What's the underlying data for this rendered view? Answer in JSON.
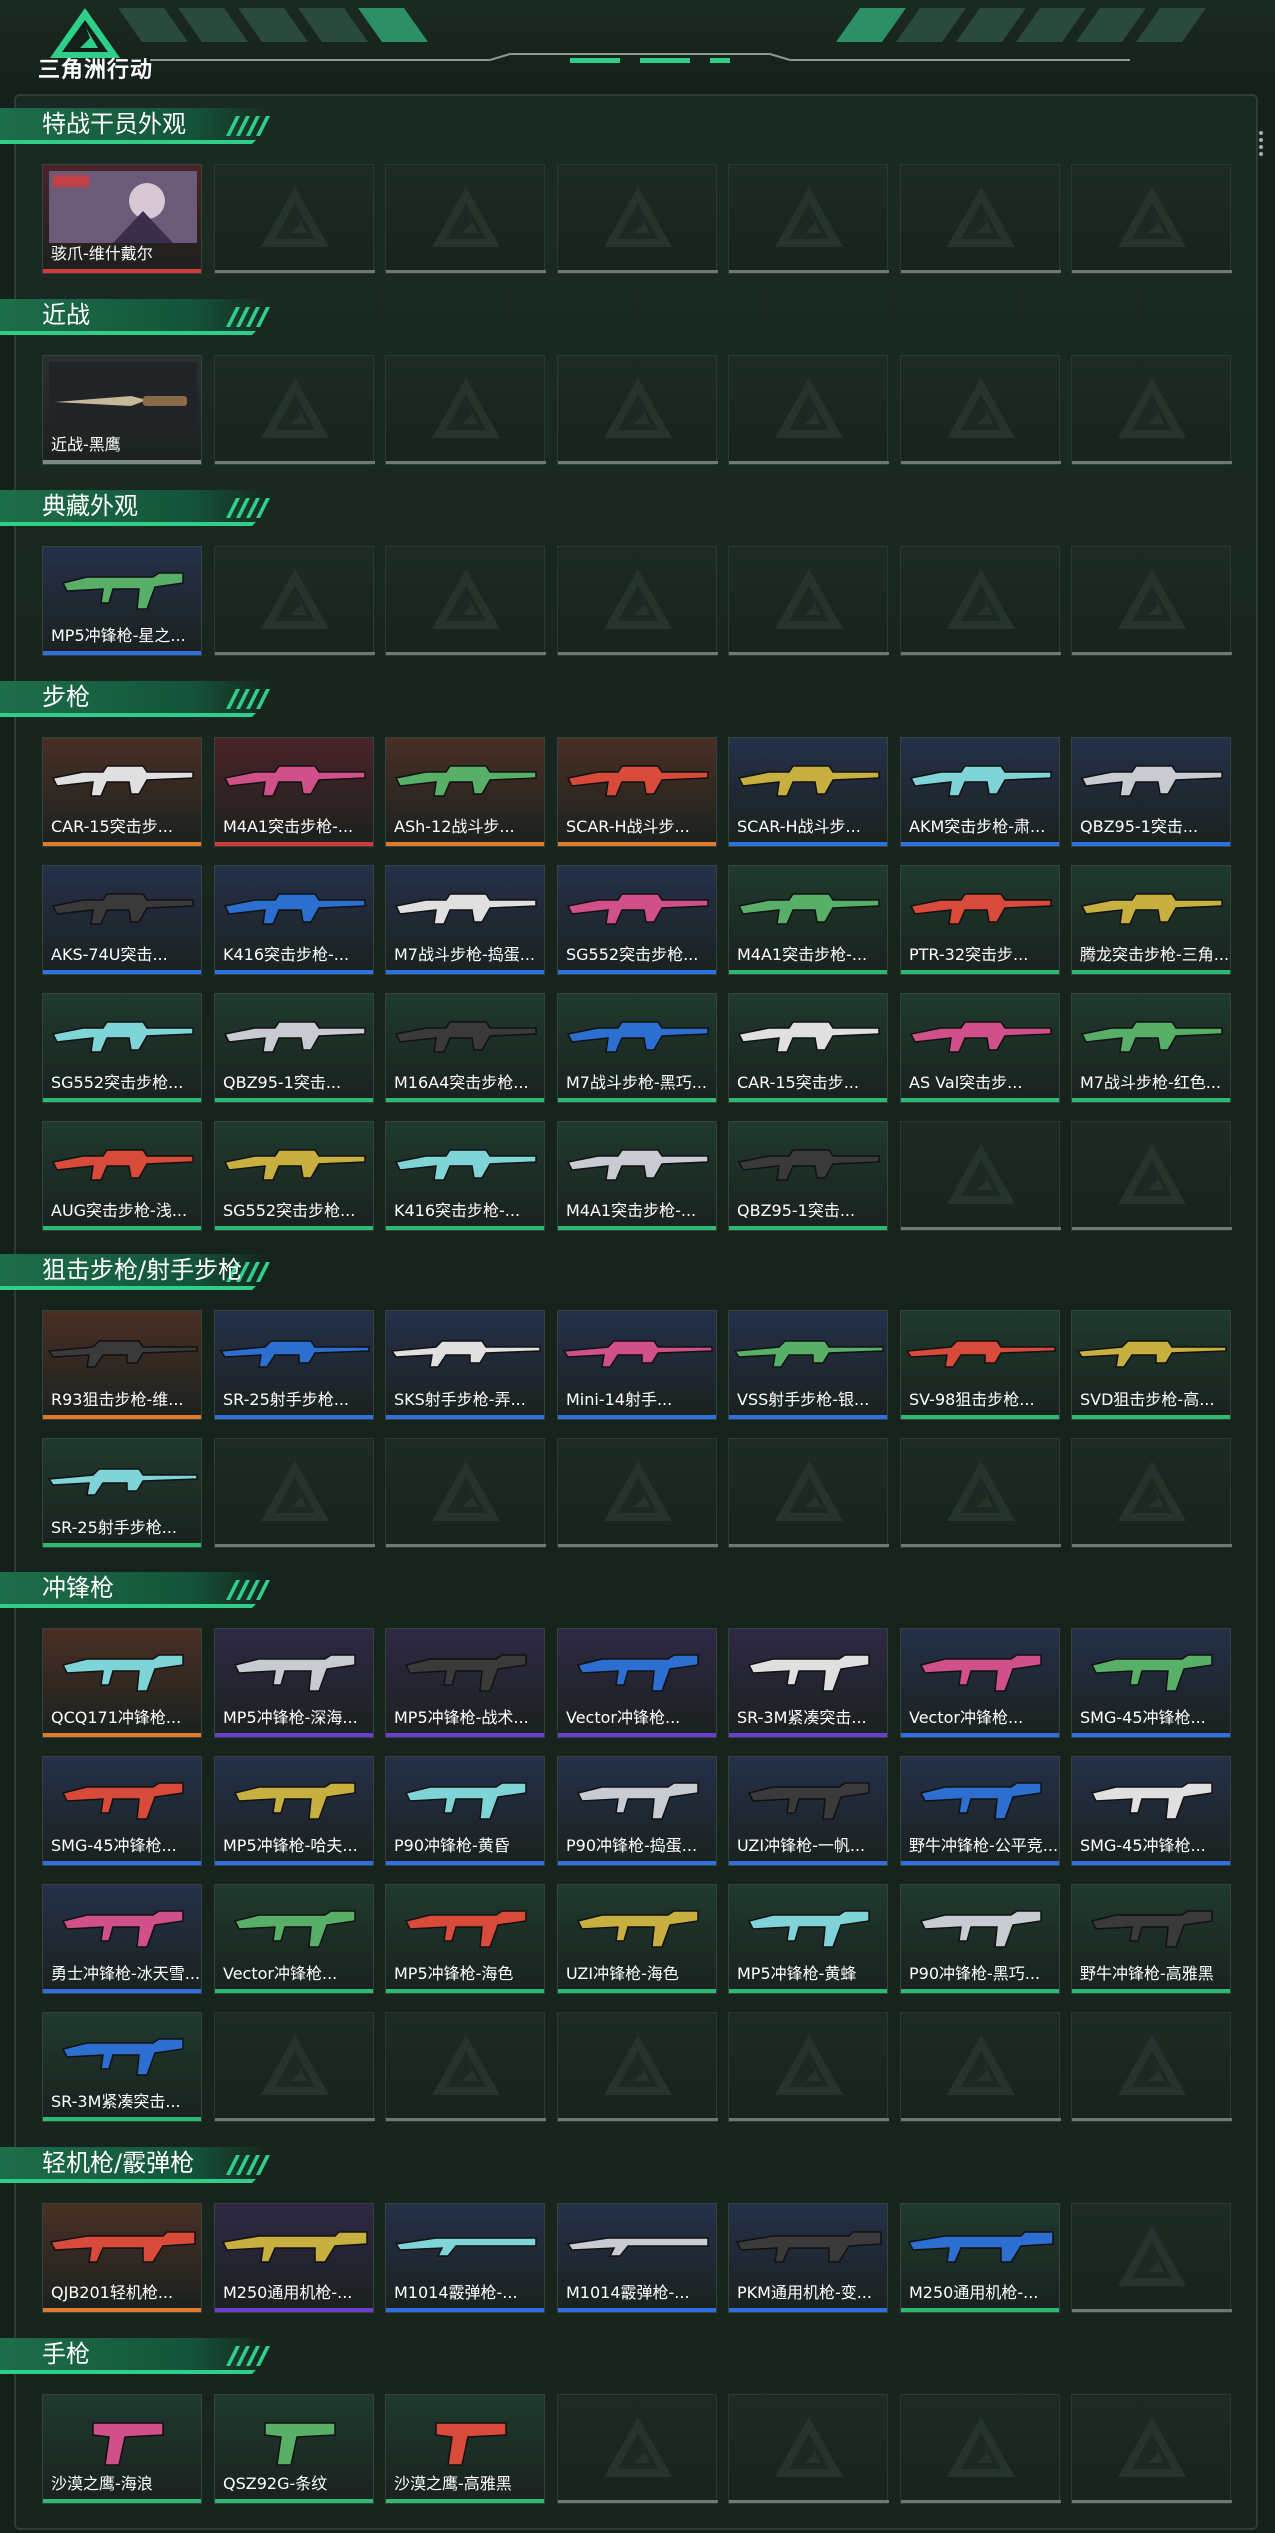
{
  "app": {
    "logo_text": "三角洲行动"
  },
  "colors": {
    "accent": "#2ecc71",
    "rarity": {
      "orange": "#e07a2e",
      "purple": "#6a3fd0",
      "blue": "#2f6fe0",
      "green": "#2eb872",
      "red": "#d43a3a",
      "gray": "#7d8a83"
    },
    "bg": {
      "orange": "#4a2f25",
      "purple": "#2f2845",
      "blue": "#25304a",
      "green": "#1f3a2e",
      "red": "#4a2328"
    }
  },
  "sections": [
    {
      "title": "特战干员外观",
      "items": [
        {
          "label": "骇爪-维什戴尔",
          "rarity": "red",
          "icon": "operator-portrait"
        }
      ]
    },
    {
      "title": "近战",
      "items": [
        {
          "label": "近战-黑鹰",
          "rarity": "gray",
          "icon": "knife-icon"
        }
      ]
    },
    {
      "title": "典藏外观",
      "items": [
        {
          "label": "MP5冲锋枪-星之...",
          "rarity": "blue",
          "icon": "smg-icon"
        }
      ]
    },
    {
      "title": "步枪",
      "items": [
        {
          "label": "CAR-15突击步...",
          "rarity": "orange",
          "icon": "rifle-icon"
        },
        {
          "label": "M4A1突击步枪-...",
          "rarity": "red",
          "icon": "rifle-icon"
        },
        {
          "label": "ASh-12战斗步...",
          "rarity": "orange",
          "icon": "rifle-icon"
        },
        {
          "label": "SCAR-H战斗步...",
          "rarity": "orange",
          "icon": "rifle-icon"
        },
        {
          "label": "SCAR-H战斗步...",
          "rarity": "blue",
          "icon": "rifle-icon"
        },
        {
          "label": "AKM突击步枪-肃...",
          "rarity": "blue",
          "icon": "rifle-icon"
        },
        {
          "label": "QBZ95-1突击...",
          "rarity": "blue",
          "icon": "rifle-icon"
        },
        {
          "label": "AKS-74U突击...",
          "rarity": "blue",
          "icon": "rifle-icon"
        },
        {
          "label": "K416突击步枪-...",
          "rarity": "blue",
          "icon": "rifle-icon"
        },
        {
          "label": "M7战斗步枪-捣蛋...",
          "rarity": "blue",
          "icon": "rifle-icon"
        },
        {
          "label": "SG552突击步枪...",
          "rarity": "blue",
          "icon": "rifle-icon"
        },
        {
          "label": "M4A1突击步枪-...",
          "rarity": "green",
          "icon": "rifle-icon"
        },
        {
          "label": "PTR-32突击步...",
          "rarity": "green",
          "icon": "rifle-icon"
        },
        {
          "label": "腾龙突击步枪-三角...",
          "rarity": "green",
          "icon": "rifle-icon"
        },
        {
          "label": "SG552突击步枪...",
          "rarity": "green",
          "icon": "rifle-icon"
        },
        {
          "label": "QBZ95-1突击...",
          "rarity": "green",
          "icon": "rifle-icon"
        },
        {
          "label": "M16A4突击步枪...",
          "rarity": "green",
          "icon": "rifle-icon"
        },
        {
          "label": "M7战斗步枪-黑巧...",
          "rarity": "green",
          "icon": "rifle-icon"
        },
        {
          "label": "CAR-15突击步...",
          "rarity": "green",
          "icon": "rifle-icon"
        },
        {
          "label": "AS Val突击步...",
          "rarity": "green",
          "icon": "rifle-icon"
        },
        {
          "label": "M7战斗步枪-红色...",
          "rarity": "green",
          "icon": "rifle-icon"
        },
        {
          "label": "AUG突击步枪-浅...",
          "rarity": "green",
          "icon": "rifle-icon"
        },
        {
          "label": "SG552突击步枪...",
          "rarity": "green",
          "icon": "rifle-icon"
        },
        {
          "label": "K416突击步枪-...",
          "rarity": "green",
          "icon": "rifle-icon"
        },
        {
          "label": "M4A1突击步枪-...",
          "rarity": "green",
          "icon": "rifle-icon"
        },
        {
          "label": "QBZ95-1突击...",
          "rarity": "green",
          "icon": "rifle-icon"
        }
      ]
    },
    {
      "title": "狙击步枪/射手步枪",
      "items": [
        {
          "label": "R93狙击步枪-维...",
          "rarity": "orange",
          "icon": "sniper-icon"
        },
        {
          "label": "SR-25射手步枪...",
          "rarity": "blue",
          "icon": "sniper-icon"
        },
        {
          "label": "SKS射手步枪-弄...",
          "rarity": "blue",
          "icon": "sniper-icon"
        },
        {
          "label": "Mini-14射手...",
          "rarity": "blue",
          "icon": "sniper-icon"
        },
        {
          "label": "VSS射手步枪-银...",
          "rarity": "blue",
          "icon": "sniper-icon"
        },
        {
          "label": "SV-98狙击步枪...",
          "rarity": "green",
          "icon": "sniper-icon"
        },
        {
          "label": "SVD狙击步枪-高...",
          "rarity": "green",
          "icon": "sniper-icon"
        },
        {
          "label": "SR-25射手步枪...",
          "rarity": "green",
          "icon": "sniper-icon"
        }
      ]
    },
    {
      "title": "冲锋枪",
      "items": [
        {
          "label": "QCQ171冲锋枪...",
          "rarity": "orange",
          "icon": "smg-icon"
        },
        {
          "label": "MP5冲锋枪-深海...",
          "rarity": "purple",
          "icon": "smg-icon"
        },
        {
          "label": "MP5冲锋枪-战术...",
          "rarity": "purple",
          "icon": "smg-icon"
        },
        {
          "label": "Vector冲锋枪...",
          "rarity": "purple",
          "icon": "smg-icon"
        },
        {
          "label": "SR-3M紧凑突击...",
          "rarity": "purple",
          "icon": "smg-icon"
        },
        {
          "label": "Vector冲锋枪...",
          "rarity": "blue",
          "icon": "smg-icon"
        },
        {
          "label": "SMG-45冲锋枪...",
          "rarity": "blue",
          "icon": "smg-icon"
        },
        {
          "label": "SMG-45冲锋枪...",
          "rarity": "blue",
          "icon": "smg-icon"
        },
        {
          "label": "MP5冲锋枪-哈夫...",
          "rarity": "blue",
          "icon": "smg-icon"
        },
        {
          "label": "P90冲锋枪-黄昏",
          "rarity": "blue",
          "icon": "smg-icon"
        },
        {
          "label": "P90冲锋枪-捣蛋...",
          "rarity": "blue",
          "icon": "smg-icon"
        },
        {
          "label": "UZI冲锋枪-一帆...",
          "rarity": "blue",
          "icon": "smg-icon"
        },
        {
          "label": "野牛冲锋枪-公平竞...",
          "rarity": "blue",
          "icon": "smg-icon"
        },
        {
          "label": "SMG-45冲锋枪...",
          "rarity": "blue",
          "icon": "smg-icon"
        },
        {
          "label": "勇士冲锋枪-冰天雪...",
          "rarity": "blue",
          "icon": "smg-icon"
        },
        {
          "label": "Vector冲锋枪...",
          "rarity": "green",
          "icon": "smg-icon"
        },
        {
          "label": "MP5冲锋枪-海色",
          "rarity": "green",
          "icon": "smg-icon"
        },
        {
          "label": "UZI冲锋枪-海色",
          "rarity": "green",
          "icon": "smg-icon"
        },
        {
          "label": "MP5冲锋枪-黄蜂",
          "rarity": "green",
          "icon": "smg-icon"
        },
        {
          "label": "P90冲锋枪-黑巧...",
          "rarity": "green",
          "icon": "smg-icon"
        },
        {
          "label": "野牛冲锋枪-高雅黑",
          "rarity": "green",
          "icon": "smg-icon"
        },
        {
          "label": "SR-3M紧凑突击...",
          "rarity": "green",
          "icon": "smg-icon"
        }
      ]
    },
    {
      "title": "轻机枪/霰弹枪",
      "items": [
        {
          "label": "QJB201轻机枪...",
          "rarity": "orange",
          "icon": "lmg-icon"
        },
        {
          "label": "M250通用机枪-...",
          "rarity": "purple",
          "icon": "lmg-icon"
        },
        {
          "label": "M1014霰弹枪-...",
          "rarity": "blue",
          "icon": "shotgun-icon"
        },
        {
          "label": "M1014霰弹枪-...",
          "rarity": "blue",
          "icon": "shotgun-icon"
        },
        {
          "label": "PKM通用机枪-变...",
          "rarity": "blue",
          "icon": "lmg-icon"
        },
        {
          "label": "M250通用机枪-...",
          "rarity": "green",
          "icon": "lmg-icon"
        }
      ]
    },
    {
      "title": "手枪",
      "items": [
        {
          "label": "沙漠之鹰-海浪",
          "rarity": "green",
          "icon": "pistol-icon"
        },
        {
          "label": "QSZ92G-条纹",
          "rarity": "green",
          "icon": "pistol-icon"
        },
        {
          "label": "沙漠之鹰-高雅黑",
          "rarity": "green",
          "icon": "pistol-icon"
        }
      ]
    }
  ]
}
